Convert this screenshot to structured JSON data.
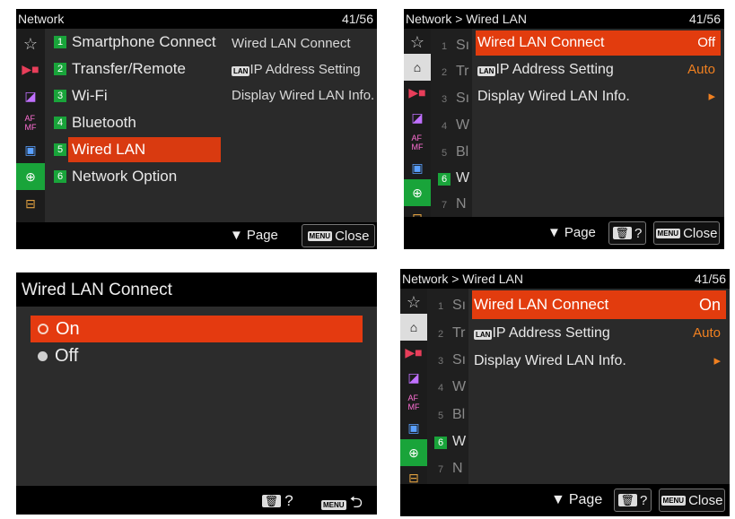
{
  "screen1": {
    "title": "Network",
    "page": "41/56",
    "menu_items": [
      {
        "num": "1",
        "label": "Smartphone Connect"
      },
      {
        "num": "2",
        "label": "Transfer/Remote"
      },
      {
        "num": "3",
        "label": "Wi-Fi"
      },
      {
        "num": "4",
        "label": "Bluetooth"
      },
      {
        "num": "5",
        "label": "Wired LAN"
      },
      {
        "num": "6",
        "label": "Network Option"
      }
    ],
    "submenu_preview": [
      "Wired LAN Connect",
      "IP Address Setting",
      "Display Wired LAN Info."
    ],
    "page_hint": "Page",
    "close": "Close",
    "menu_icon_text": "MENU"
  },
  "screen2": {
    "breadcrumb": "Network > Wired LAN",
    "page": "41/56",
    "rows": [
      {
        "label": "Wired LAN Connect",
        "value": "Off"
      },
      {
        "label": "IP Address Setting",
        "value": "Auto"
      },
      {
        "label": "Display Wired LAN Info.",
        "value": "▸"
      }
    ],
    "truncated": [
      "Sı",
      "Tr",
      "Sı",
      "W",
      "Bl",
      "W",
      "N"
    ],
    "nums": [
      "1",
      "2",
      "3",
      "4",
      "5",
      "6",
      "7"
    ],
    "page_hint": "Page",
    "help": "?",
    "close": "Close",
    "menu_icon_text": "MENU"
  },
  "screen3": {
    "title": "Wired LAN Connect",
    "options": [
      "On",
      "Off"
    ],
    "help": "?",
    "menu_icon_text": "MENU",
    "back": "⮌"
  },
  "screen4": {
    "breadcrumb": "Network > Wired LAN",
    "page": "41/56",
    "rows": [
      {
        "label": "Wired LAN Connect",
        "value": "On"
      },
      {
        "label": "IP Address Setting",
        "value": "Auto"
      },
      {
        "label": "Display Wired LAN Info.",
        "value": "▸"
      }
    ],
    "truncated": [
      "Sı",
      "Tr",
      "Sı",
      "W",
      "Bl",
      "W",
      "N"
    ],
    "nums": [
      "1",
      "2",
      "3",
      "4",
      "5",
      "6",
      "7"
    ],
    "page_hint": "Page",
    "help": "?",
    "close": "Close",
    "menu_icon_text": "MENU"
  },
  "colors": {
    "selected": "#e23c0e",
    "value_orange": "#f08020",
    "number_green": "#19a43a"
  },
  "icons": [
    "star-icon",
    "camera-icon",
    "exposure-icon",
    "af-mf-icon",
    "playback-icon",
    "globe-icon",
    "toolbox-icon",
    "house-icon",
    "lan-icon",
    "trash-icon"
  ]
}
